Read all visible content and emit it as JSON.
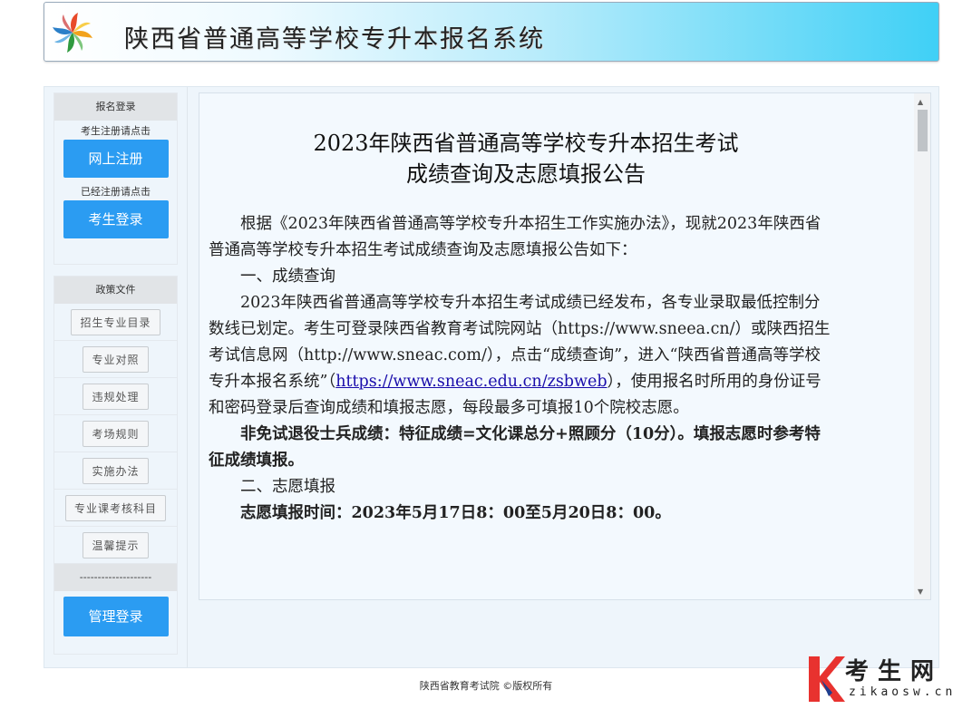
{
  "header": {
    "title": "陕西省普通高等学校专升本报名系统"
  },
  "sidebar": {
    "login_section": {
      "heading": "报名登录",
      "register_hint": "考生注册请点击",
      "register_button": "网上注册",
      "login_hint": "已经注册请点击",
      "login_button": "考生登录"
    },
    "policy_section": {
      "heading": "政策文件",
      "items": [
        "招生专业目录",
        "专业对照",
        "违规处理",
        "考场规则",
        "实施办法",
        "专业课考核科目",
        "温馨提示"
      ]
    },
    "divider": "--------------------",
    "admin_button": "管理登录"
  },
  "notice": {
    "title_line1": "2023年陕西省普通高等学校专升本招生考试",
    "title_line2": "成绩查询及志愿填报公告",
    "intro": "根据《2023年陕西省普通高等学校专升本招生工作实施办法》，现就2023年陕西省普通高等学校专升本招生考试成绩查询及志愿填报公告如下：",
    "section1_heading": "一、成绩查询",
    "section1_text_a": "2023年陕西省普通高等学校专升本招生考试成绩已经发布，各专业录取最低控制分数线已划定。考生可登录陕西省教育考试院网站（https://www.sneea.cn/）或陕西招生考试信息网（http://www.sneac.com/），点击“成绩查询”，进入“陕西省普通高等学校专升本报名系统”（",
    "section1_link": "https://www.sneac.edu.cn/zsbweb",
    "section1_text_b": "），使用报名时所用的身份证号和密码登录后查询成绩和填报志愿，每段最多可填报10个院校志愿。",
    "bold_note": "非免试退役士兵成绩：特征成绩=文化课总分+照顾分（10分）。填报志愿时参考特征成绩填报。",
    "section2_heading": "二、志愿填报",
    "section2_time": "志愿填报时间：2023年5月17日8：00至5月20日8：00。"
  },
  "footer": {
    "copyright": "陕西省教育考试院 ©版权所有"
  },
  "watermark": {
    "main": "考生网",
    "sub": "zikaosw.cn"
  },
  "colors": {
    "accent_blue": "#2b9cf2",
    "header_gradient_end": "#3fd0f6",
    "panel_bg": "#f3f9fe"
  }
}
